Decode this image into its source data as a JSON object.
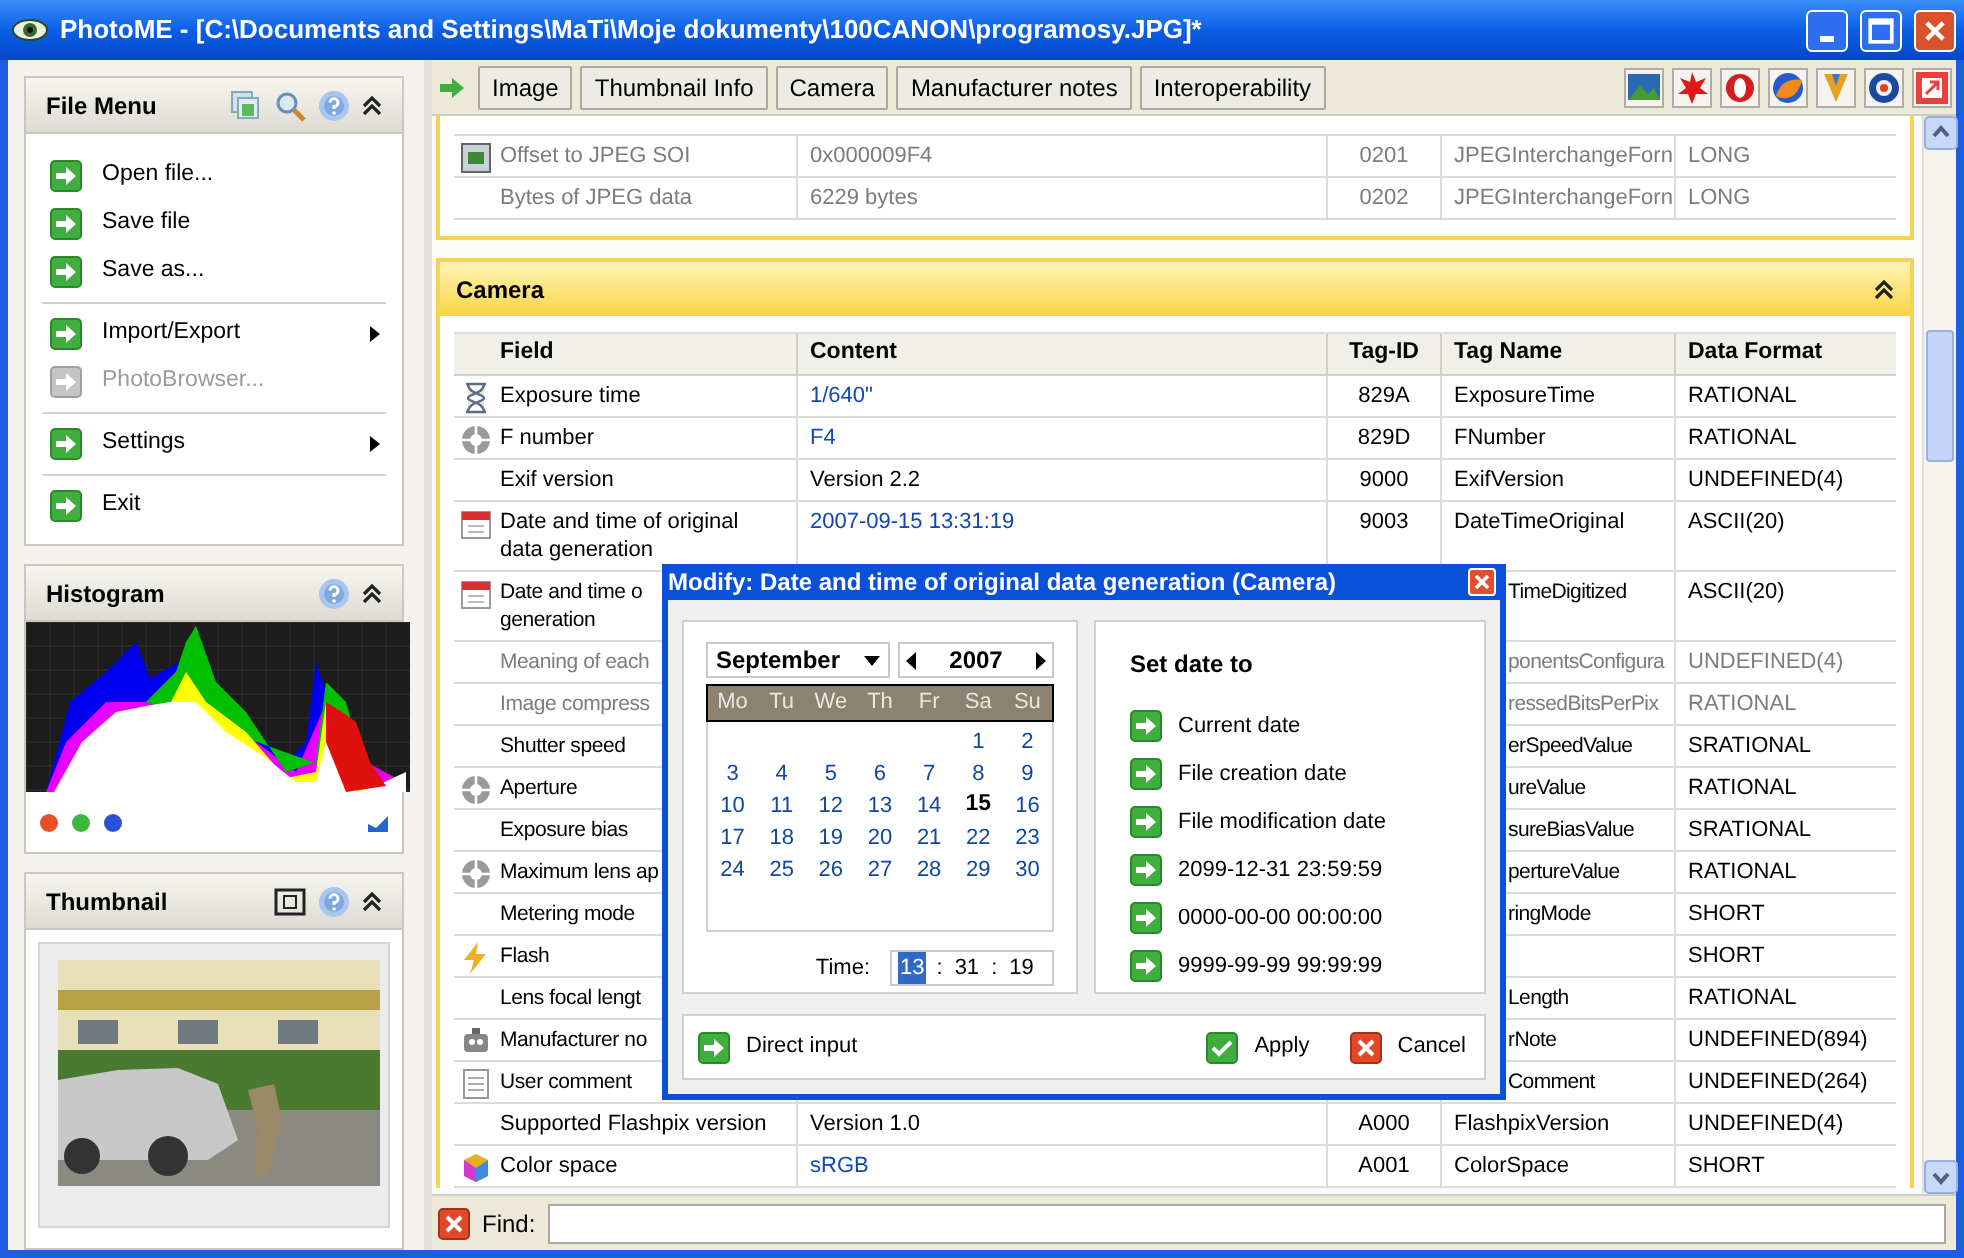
{
  "window": {
    "title": "PhotoME - [C:\\Documents and Settings\\MaTi\\Moje dokumenty\\100CANON\\programosy.JPG]*"
  },
  "file_menu": {
    "title": "File Menu",
    "groups": [
      [
        {
          "label": "Open file...",
          "disabled": false,
          "submenu": false
        },
        {
          "label": "Save file",
          "disabled": false,
          "submenu": false
        },
        {
          "label": "Save as...",
          "disabled": false,
          "submenu": false
        }
      ],
      [
        {
          "label": "Import/Export",
          "disabled": false,
          "submenu": true
        },
        {
          "label": "PhotoBrowser...",
          "disabled": true,
          "submenu": false
        }
      ],
      [
        {
          "label": "Settings",
          "disabled": false,
          "submenu": true
        }
      ],
      [
        {
          "label": "Exit",
          "disabled": false,
          "submenu": false
        }
      ]
    ]
  },
  "histogram": {
    "title": "Histogram",
    "channels": [
      {
        "color": "#e8502a"
      },
      {
        "color": "#3cb83c"
      },
      {
        "color": "#2a50d8"
      }
    ]
  },
  "thumbnail": {
    "title": "Thumbnail"
  },
  "toolbar": {
    "tabs": [
      "Image",
      "Thumbnail Info",
      "Camera",
      "Manufacturer notes",
      "Interoperability"
    ]
  },
  "top_section": {
    "rows": [
      {
        "kind": "jpeg",
        "greyed": true,
        "field": "Offset to JPEG SOI",
        "content": "0x000009F4",
        "editable": false,
        "tag_id": "0201",
        "tag_name": "JPEGInterchangeForn",
        "data_format": "LONG"
      },
      {
        "kind": "plain",
        "greyed": true,
        "field": "Bytes of JPEG data",
        "content": "6229 bytes",
        "editable": false,
        "tag_id": "0202",
        "tag_name": "JPEGInterchangeForn",
        "data_format": "LONG"
      }
    ]
  },
  "camera": {
    "title": "Camera",
    "columns": [
      "Field",
      "Content",
      "Tag-ID",
      "Tag Name",
      "Data Format"
    ],
    "rows": [
      {
        "kind": "time",
        "greyed": false,
        "field": "Exposure time",
        "content": "1/640\"",
        "editable": true,
        "tag_id": "829A",
        "tag_name": "ExposureTime",
        "data_format": "RATIONAL"
      },
      {
        "kind": "aperture",
        "greyed": false,
        "field": "F number",
        "content": "F4",
        "editable": true,
        "tag_id": "829D",
        "tag_name": "FNumber",
        "data_format": "RATIONAL"
      },
      {
        "kind": "plain",
        "greyed": false,
        "field": "Exif version",
        "content": "Version 2.2",
        "editable": false,
        "tag_id": "9000",
        "tag_name": "ExifVersion",
        "data_format": "UNDEFINED(4)"
      },
      {
        "kind": "date",
        "greyed": false,
        "field": "Date and time of original\ndata generation",
        "content": "2007-09-15 13:31:19",
        "editable": true,
        "tag_id": "9003",
        "tag_name": "DateTimeOriginal",
        "data_format": "ASCII(20)"
      },
      {
        "kind": "date",
        "greyed": false,
        "field": "Date and time o\ngeneration",
        "tag_name": "TimeDigitized",
        "data_format": "ASCII(20)"
      },
      {
        "kind": "plain",
        "greyed": true,
        "field": "Meaning of each",
        "tag_name": "ponentsConfigura",
        "data_format": "UNDEFINED(4)"
      },
      {
        "kind": "plain",
        "greyed": true,
        "field": "Image compress",
        "tag_name": "ressedBitsPerPix",
        "data_format": "RATIONAL"
      },
      {
        "kind": "plain",
        "greyed": false,
        "field": "Shutter speed",
        "tag_name": "erSpeedValue",
        "data_format": "SRATIONAL"
      },
      {
        "kind": "aperture",
        "greyed": false,
        "field": "Aperture",
        "tag_name": "ureValue",
        "data_format": "RATIONAL"
      },
      {
        "kind": "plain",
        "greyed": false,
        "field": "Exposure bias",
        "tag_name": "sureBiasValue",
        "data_format": "SRATIONAL"
      },
      {
        "kind": "aperture",
        "greyed": false,
        "field": "Maximum lens ap",
        "tag_name": "pertureValue",
        "data_format": "RATIONAL"
      },
      {
        "kind": "plain",
        "greyed": false,
        "field": "Metering mode",
        "tag_name": "ringMode",
        "data_format": "SHORT"
      },
      {
        "kind": "flash",
        "greyed": false,
        "field": "Flash",
        "data_format": "SHORT"
      },
      {
        "kind": "plain",
        "greyed": false,
        "field": "Lens focal lengt",
        "tag_name": "Length",
        "data_format": "RATIONAL"
      },
      {
        "kind": "device",
        "greyed": false,
        "field": "Manufacturer no",
        "tag_name": "rNote",
        "data_format": "UNDEFINED(894)"
      },
      {
        "kind": "comment",
        "greyed": false,
        "field": "User comment",
        "tag_name": "Comment",
        "data_format": "UNDEFINED(264)"
      },
      {
        "kind": "plain",
        "greyed": false,
        "field": "Supported Flashpix version",
        "content": "Version 1.0",
        "editable": false,
        "tag_id": "A000",
        "tag_name": "FlashpixVersion",
        "data_format": "UNDEFINED(4)"
      },
      {
        "kind": "cube",
        "greyed": false,
        "field": "Color space",
        "content": "sRGB",
        "editable": true,
        "tag_id": "A001",
        "tag_name": "ColorSpace",
        "data_format": "SHORT"
      }
    ]
  },
  "find": {
    "label": "Find:"
  },
  "dialog": {
    "title": "Modify: Date and time of original data generation (Camera)",
    "calendar": {
      "month": "September",
      "year": "2007",
      "weekdays": [
        "Mo",
        "Tu",
        "We",
        "Th",
        "Fr",
        "Sa",
        "Su"
      ],
      "weeks": [
        [
          {
            "day": "1",
            "selected": false
          },
          {
            "day": "2",
            "selected": false
          }
        ],
        [
          {
            "day": "3",
            "selected": false
          },
          {
            "day": "4",
            "selected": false
          },
          {
            "day": "5",
            "selected": false
          },
          {
            "day": "6",
            "selected": false
          },
          {
            "day": "7",
            "selected": false
          },
          {
            "day": "8",
            "selected": false
          },
          {
            "day": "9",
            "selected": false
          }
        ],
        [
          {
            "day": "10",
            "selected": false
          },
          {
            "day": "11",
            "selected": false
          },
          {
            "day": "12",
            "selected": false
          },
          {
            "day": "13",
            "selected": false
          },
          {
            "day": "14",
            "selected": false
          },
          {
            "day": "15",
            "selected": true
          },
          {
            "day": "16",
            "selected": false
          }
        ],
        [
          {
            "day": "17",
            "selected": false
          },
          {
            "day": "18",
            "selected": false
          },
          {
            "day": "19",
            "selected": false
          },
          {
            "day": "20",
            "selected": false
          },
          {
            "day": "21",
            "selected": false
          },
          {
            "day": "22",
            "selected": false
          },
          {
            "day": "23",
            "selected": false
          }
        ],
        [
          {
            "day": "24",
            "selected": false
          },
          {
            "day": "25",
            "selected": false
          },
          {
            "day": "26",
            "selected": false
          },
          {
            "day": "27",
            "selected": false
          },
          {
            "day": "28",
            "selected": false
          },
          {
            "day": "29",
            "selected": false
          },
          {
            "day": "30",
            "selected": false
          }
        ]
      ]
    },
    "time": {
      "label": "Time:",
      "parts": [
        {
          "kind": "field",
          "value": "13",
          "selected": true
        },
        {
          "kind": "sep",
          "value": ":"
        },
        {
          "kind": "field",
          "value": "31",
          "selected": false
        },
        {
          "kind": "sep",
          "value": ":"
        },
        {
          "kind": "field",
          "value": "19",
          "selected": false
        }
      ]
    },
    "set_date": {
      "title": "Set date to",
      "options": [
        "Current date",
        "File creation date",
        "File modification date",
        "2099-12-31 23:59:59",
        "0000-00-00 00:00:00",
        "9999-99-99 99:99:99"
      ]
    },
    "direct_input": "Direct input",
    "buttons": [
      {
        "kind": "apply",
        "label": "Apply"
      },
      {
        "kind": "cancel",
        "label": "Cancel"
      }
    ]
  }
}
